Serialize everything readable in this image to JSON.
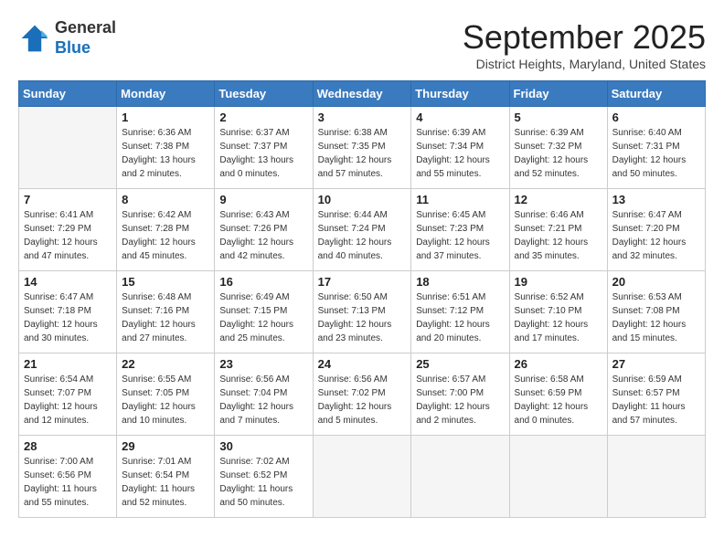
{
  "logo": {
    "general": "General",
    "blue": "Blue"
  },
  "title": "September 2025",
  "location": "District Heights, Maryland, United States",
  "weekdays": [
    "Sunday",
    "Monday",
    "Tuesday",
    "Wednesday",
    "Thursday",
    "Friday",
    "Saturday"
  ],
  "weeks": [
    [
      {
        "day": "",
        "info": ""
      },
      {
        "day": "1",
        "info": "Sunrise: 6:36 AM\nSunset: 7:38 PM\nDaylight: 13 hours\nand 2 minutes."
      },
      {
        "day": "2",
        "info": "Sunrise: 6:37 AM\nSunset: 7:37 PM\nDaylight: 13 hours\nand 0 minutes."
      },
      {
        "day": "3",
        "info": "Sunrise: 6:38 AM\nSunset: 7:35 PM\nDaylight: 12 hours\nand 57 minutes."
      },
      {
        "day": "4",
        "info": "Sunrise: 6:39 AM\nSunset: 7:34 PM\nDaylight: 12 hours\nand 55 minutes."
      },
      {
        "day": "5",
        "info": "Sunrise: 6:39 AM\nSunset: 7:32 PM\nDaylight: 12 hours\nand 52 minutes."
      },
      {
        "day": "6",
        "info": "Sunrise: 6:40 AM\nSunset: 7:31 PM\nDaylight: 12 hours\nand 50 minutes."
      }
    ],
    [
      {
        "day": "7",
        "info": "Sunrise: 6:41 AM\nSunset: 7:29 PM\nDaylight: 12 hours\nand 47 minutes."
      },
      {
        "day": "8",
        "info": "Sunrise: 6:42 AM\nSunset: 7:28 PM\nDaylight: 12 hours\nand 45 minutes."
      },
      {
        "day": "9",
        "info": "Sunrise: 6:43 AM\nSunset: 7:26 PM\nDaylight: 12 hours\nand 42 minutes."
      },
      {
        "day": "10",
        "info": "Sunrise: 6:44 AM\nSunset: 7:24 PM\nDaylight: 12 hours\nand 40 minutes."
      },
      {
        "day": "11",
        "info": "Sunrise: 6:45 AM\nSunset: 7:23 PM\nDaylight: 12 hours\nand 37 minutes."
      },
      {
        "day": "12",
        "info": "Sunrise: 6:46 AM\nSunset: 7:21 PM\nDaylight: 12 hours\nand 35 minutes."
      },
      {
        "day": "13",
        "info": "Sunrise: 6:47 AM\nSunset: 7:20 PM\nDaylight: 12 hours\nand 32 minutes."
      }
    ],
    [
      {
        "day": "14",
        "info": "Sunrise: 6:47 AM\nSunset: 7:18 PM\nDaylight: 12 hours\nand 30 minutes."
      },
      {
        "day": "15",
        "info": "Sunrise: 6:48 AM\nSunset: 7:16 PM\nDaylight: 12 hours\nand 27 minutes."
      },
      {
        "day": "16",
        "info": "Sunrise: 6:49 AM\nSunset: 7:15 PM\nDaylight: 12 hours\nand 25 minutes."
      },
      {
        "day": "17",
        "info": "Sunrise: 6:50 AM\nSunset: 7:13 PM\nDaylight: 12 hours\nand 23 minutes."
      },
      {
        "day": "18",
        "info": "Sunrise: 6:51 AM\nSunset: 7:12 PM\nDaylight: 12 hours\nand 20 minutes."
      },
      {
        "day": "19",
        "info": "Sunrise: 6:52 AM\nSunset: 7:10 PM\nDaylight: 12 hours\nand 17 minutes."
      },
      {
        "day": "20",
        "info": "Sunrise: 6:53 AM\nSunset: 7:08 PM\nDaylight: 12 hours\nand 15 minutes."
      }
    ],
    [
      {
        "day": "21",
        "info": "Sunrise: 6:54 AM\nSunset: 7:07 PM\nDaylight: 12 hours\nand 12 minutes."
      },
      {
        "day": "22",
        "info": "Sunrise: 6:55 AM\nSunset: 7:05 PM\nDaylight: 12 hours\nand 10 minutes."
      },
      {
        "day": "23",
        "info": "Sunrise: 6:56 AM\nSunset: 7:04 PM\nDaylight: 12 hours\nand 7 minutes."
      },
      {
        "day": "24",
        "info": "Sunrise: 6:56 AM\nSunset: 7:02 PM\nDaylight: 12 hours\nand 5 minutes."
      },
      {
        "day": "25",
        "info": "Sunrise: 6:57 AM\nSunset: 7:00 PM\nDaylight: 12 hours\nand 2 minutes."
      },
      {
        "day": "26",
        "info": "Sunrise: 6:58 AM\nSunset: 6:59 PM\nDaylight: 12 hours\nand 0 minutes."
      },
      {
        "day": "27",
        "info": "Sunrise: 6:59 AM\nSunset: 6:57 PM\nDaylight: 11 hours\nand 57 minutes."
      }
    ],
    [
      {
        "day": "28",
        "info": "Sunrise: 7:00 AM\nSunset: 6:56 PM\nDaylight: 11 hours\nand 55 minutes."
      },
      {
        "day": "29",
        "info": "Sunrise: 7:01 AM\nSunset: 6:54 PM\nDaylight: 11 hours\nand 52 minutes."
      },
      {
        "day": "30",
        "info": "Sunrise: 7:02 AM\nSunset: 6:52 PM\nDaylight: 11 hours\nand 50 minutes."
      },
      {
        "day": "",
        "info": ""
      },
      {
        "day": "",
        "info": ""
      },
      {
        "day": "",
        "info": ""
      },
      {
        "day": "",
        "info": ""
      }
    ]
  ]
}
